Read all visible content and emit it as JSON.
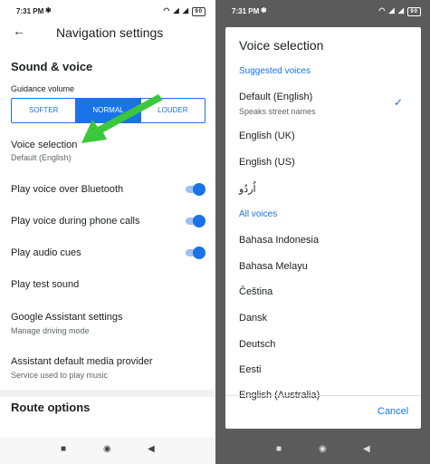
{
  "left": {
    "status": {
      "time": "7:31 PM",
      "battery": "90"
    },
    "header": {
      "title": "Navigation settings"
    },
    "sound_voice": {
      "heading": "Sound & voice",
      "guidance_label": "Guidance volume"
    },
    "volume_options": [
      "SOFTER",
      "NORMAL",
      "LOUDER"
    ],
    "volume_selected": "NORMAL",
    "rows": {
      "voice_selection": {
        "title": "Voice selection",
        "sub": "Default (English)"
      },
      "bluetooth": {
        "title": "Play voice over Bluetooth",
        "on": true
      },
      "phone_calls": {
        "title": "Play voice during phone calls",
        "on": true
      },
      "audio_cues": {
        "title": "Play audio cues",
        "on": true
      },
      "test_sound": {
        "title": "Play test sound"
      },
      "assistant": {
        "title": "Google Assistant settings",
        "sub": "Manage driving mode"
      },
      "media_provider": {
        "title": "Assistant default media provider",
        "sub": "Service used to play music"
      }
    },
    "route_heading": "Route options"
  },
  "right": {
    "status": {
      "time": "7:31 PM",
      "battery": "90"
    },
    "dialog": {
      "title": "Voice selection",
      "suggested_heading": "Suggested voices",
      "suggested": [
        {
          "label": "Default (English)",
          "sub": "Speaks street names",
          "selected": true
        },
        {
          "label": "English (UK)"
        },
        {
          "label": "English (US)"
        },
        {
          "label": "اُردُو"
        }
      ],
      "all_heading": "All voices",
      "all": [
        "Bahasa Indonesia",
        "Bahasa Melayu",
        "Čeština",
        "Dansk",
        "Deutsch",
        "Eesti",
        "English (Australia)"
      ],
      "cancel": "Cancel"
    }
  },
  "colors": {
    "accent": "#1a73e8",
    "arrow": "#3cc73c",
    "overlay": "#5b5b5b"
  },
  "icons": [
    "back-arrow-icon",
    "gear-icon",
    "wifi-icon",
    "signal-icon",
    "battery-icon",
    "check-icon",
    "nav-square-icon",
    "nav-circle-icon",
    "nav-triangle-icon"
  ]
}
